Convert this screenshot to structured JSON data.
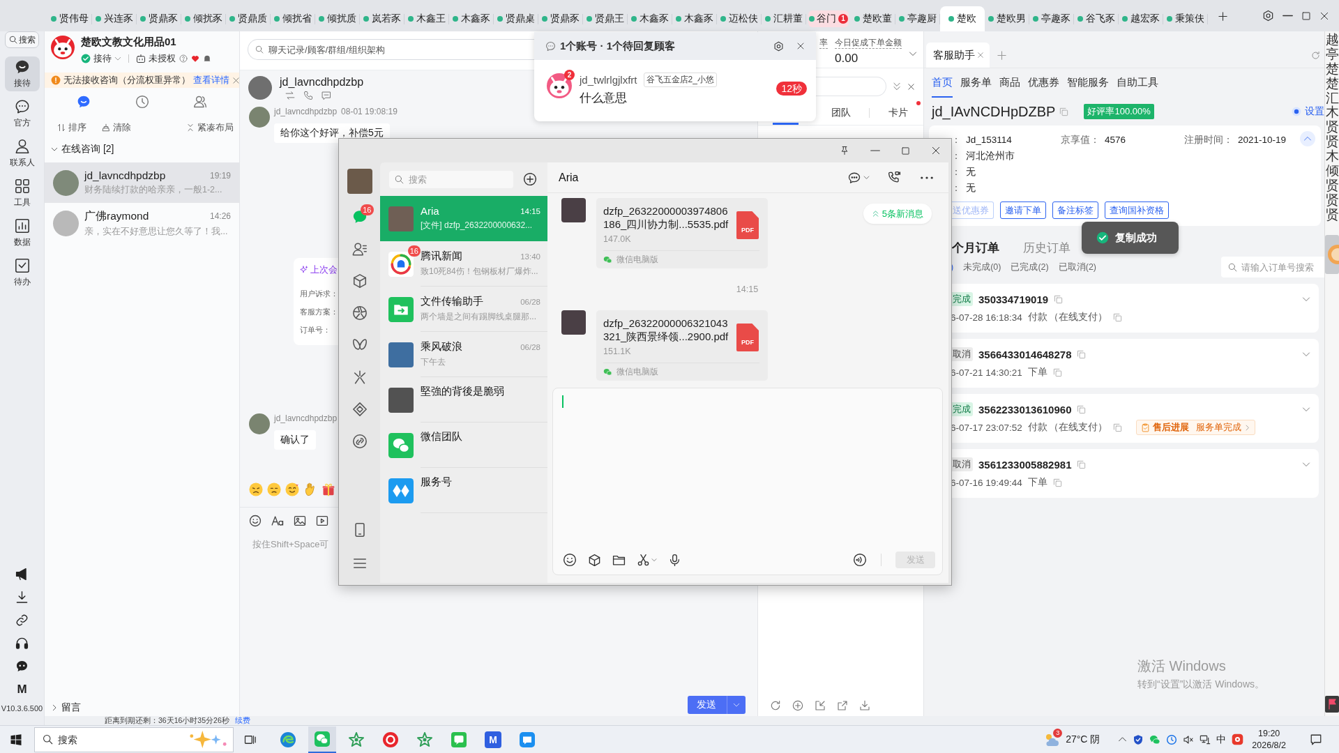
{
  "shop_tabs": [
    {
      "label": "贤伟母",
      "selected": false
    },
    {
      "label": "兴连豕",
      "selected": false
    },
    {
      "label": "贤鼎豕",
      "selected": false
    },
    {
      "label": "倾扰豕",
      "selected": false
    },
    {
      "label": "贤鼎质",
      "selected": false
    },
    {
      "label": "倾扰省",
      "selected": false
    },
    {
      "label": "倾扰质",
      "selected": false
    },
    {
      "label": "岚若豕",
      "selected": false
    },
    {
      "label": "木鑫王",
      "selected": false
    },
    {
      "label": "木鑫豕",
      "selected": false
    },
    {
      "label": "贤鼎桌",
      "selected": false
    },
    {
      "label": "贤鼎豕",
      "selected": false
    },
    {
      "label": "贤鼎王",
      "selected": false
    },
    {
      "label": "木鑫豕",
      "selected": false
    },
    {
      "label": "木鑫豕",
      "selected": false
    },
    {
      "label": "迈松伕",
      "selected": false
    },
    {
      "label": "汇耕董",
      "selected": false
    },
    {
      "label": "谷门",
      "selected": false,
      "badge": "1"
    },
    {
      "label": "楚欧董",
      "selected": false
    },
    {
      "label": "亭趣厨",
      "selected": false
    },
    {
      "label": "楚欧",
      "selected": true
    },
    {
      "label": "楚欧男",
      "selected": false
    },
    {
      "label": "亭趣豕",
      "selected": false
    },
    {
      "label": "谷飞豕",
      "selected": false
    },
    {
      "label": "越宏豕",
      "selected": false
    },
    {
      "label": "秉策伕",
      "selected": false
    }
  ],
  "rail": {
    "search": "搜索",
    "items": [
      {
        "label": "接待",
        "selected": true
      },
      {
        "label": "官方",
        "selected": false
      },
      {
        "label": "联系人",
        "selected": false
      },
      {
        "label": "工具",
        "selected": false
      },
      {
        "label": "数据",
        "selected": false
      },
      {
        "label": "待办",
        "selected": false
      }
    ],
    "brand_letter": "M",
    "version": "V10.3.6.500"
  },
  "account": {
    "name": "楚欧文教文化用品01",
    "status": "接待",
    "auth": "未授权"
  },
  "notice": {
    "text": "无法接收咨询（分流权重异常）",
    "link": "查看详情"
  },
  "list_tabs": [
    {
      "selected": true
    },
    {
      "selected": false
    },
    {
      "selected": false
    }
  ],
  "list_tools": [
    "排序",
    "清除",
    "紧凑布局"
  ],
  "consult_group": {
    "label": "在线咨询 [2]",
    "expanded": true
  },
  "conversations": [
    {
      "name": "jd_lavncdhpdzbp",
      "time": "19:19",
      "preview": "财务陆续打款的哈亲亲，一般1-2...",
      "selected": true
    },
    {
      "name": "广佛raymond",
      "time": "14:26",
      "preview": "亲，实在不好意思让您久等了！我...",
      "selected": false
    }
  ],
  "message_group": {
    "label": "留言",
    "expanded": false
  },
  "chat": {
    "search_placeholder": "聊天记录/顾客/群组/组织架构",
    "contact": "jd_lavncdhpdzbp",
    "messages": [
      {
        "kind": "text",
        "sender": "jd_lavncdhpdzbp",
        "time": "08-01 19:08:19",
        "text": "给你这个好评，补偿5元"
      },
      {
        "kind": "summary",
        "title": "上次会",
        "lines": [
          "用户诉求：",
          "客服方案：",
          "订单号："
        ]
      },
      {
        "kind": "text",
        "sender": "jd_lavncdhpdzbp",
        "text": "确认了"
      }
    ],
    "input_placeholder": "按住Shift+Space可",
    "send": "发送"
  },
  "expiry": {
    "text": "距离到期还剩：36天16小时35分26秒",
    "link": "续费"
  },
  "stats": [
    {
      "label": "率"
    },
    {
      "label": "今日促成下单金额",
      "value": "0.00"
    }
  ],
  "data_tabs": [
    {
      "selected": true
    },
    {
      "label": "团队",
      "selected": false
    },
    {
      "label": "卡片",
      "selected": false,
      "unread": true
    }
  ],
  "assistant": {
    "tabs": [
      {
        "label": "客服助手",
        "selected": true
      }
    ],
    "nav": [
      {
        "label": "首页",
        "selected": true
      },
      {
        "label": "服务单",
        "selected": false
      },
      {
        "label": "商品",
        "selected": false
      },
      {
        "label": "优惠券",
        "selected": false
      },
      {
        "label": "智能服务",
        "selected": false
      },
      {
        "label": "自助工具",
        "selected": false
      }
    ],
    "customer": {
      "id": "jd_IAvNCDHpDZBP",
      "rating": "好评率100.00%",
      "setting": "设置",
      "setting_on": true
    },
    "info": [
      {
        "label": "：",
        "value": "Jd_153114"
      },
      {
        "label": "京享值：",
        "value": "4576"
      },
      {
        "label": "注册时间：",
        "value": "2021-10-19"
      },
      {
        "label": "：",
        "value": "河北沧州市"
      },
      {
        "label": "：",
        "value": "无"
      },
      {
        "label": "：",
        "value": "无"
      }
    ],
    "info_expanded": true,
    "actions": [
      {
        "label": "送优惠券",
        "disabled": true
      },
      {
        "label": "邀请下单",
        "disabled": false
      },
      {
        "label": "备注标签",
        "disabled": false
      },
      {
        "label": "查询国补资格",
        "disabled": false
      }
    ],
    "order_tabs": [
      {
        "label": "个月订单",
        "selected": true
      },
      {
        "label": "历史订单",
        "selected": false
      }
    ],
    "filters": [
      {
        "label": ")",
        "selected": true
      },
      {
        "label": "未完成(0)",
        "selected": false
      },
      {
        "label": "已完成(2)",
        "selected": false
      },
      {
        "label": "已取消(2)",
        "selected": false
      }
    ],
    "order_search_placeholder": "请输入订单号搜索",
    "orders": [
      {
        "kind": "done",
        "status": "完成",
        "number": "350334719019",
        "time": "6-07-28 16:18:34",
        "action": "付款",
        "payment": "（在线支付）",
        "expanded": false
      },
      {
        "kind": "cancelled",
        "status": "取消",
        "number": "3566433014648278",
        "time": "6-07-21 14:30:21",
        "action": "下单",
        "expanded": false
      },
      {
        "kind": "done",
        "status": "完成",
        "number": "3562233013610960",
        "time": "6-07-17 23:07:52",
        "action": "付款",
        "payment": "（在线支付）",
        "after_sale": {
          "label": "售后进展",
          "status": "服务单完成"
        },
        "expanded": false
      },
      {
        "kind": "cancelled",
        "status": "取消",
        "number": "3561233005882981",
        "time": "6-07-16 19:49:44",
        "action": "下单",
        "expanded": false
      }
    ]
  },
  "side_strip": {
    "text": "越亭楚楚汇木贤贤木倾贤贤贤"
  },
  "notification": {
    "title": "1个账号 · 1个待回复顾客",
    "items": [
      {
        "name": "jd_twlrlgjlxfrt",
        "badge": "2",
        "tag": "谷飞五金店2_小悠",
        "message": "什么意思",
        "wait": "12秒"
      }
    ]
  },
  "wechat": {
    "nav": [
      {
        "selected": true,
        "badge": "16"
      },
      {
        "selected": false
      },
      {
        "selected": false
      },
      {
        "selected": false
      },
      {
        "selected": false
      },
      {
        "selected": false
      },
      {
        "selected": false
      },
      {
        "selected": false
      }
    ],
    "search_placeholder": "搜索",
    "chats": [
      {
        "kind": "photo",
        "name": "Aria",
        "time": "14:15",
        "preview": "[文件] dzfp_2632200000632...",
        "selected": true
      },
      {
        "kind": "news",
        "name": "腾讯新闻",
        "time": "13:40",
        "preview": "致10死84伤！包钢板材厂爆炸...",
        "badge": "16",
        "selected": false
      },
      {
        "kind": "files",
        "name": "文件传输助手",
        "time": "06/28",
        "preview": "两个墙是之间有踢脚线桌腿那...",
        "selected": false
      },
      {
        "kind": "photo",
        "name": "乘风破浪",
        "time": "06/28",
        "preview": "下午去",
        "selected": false
      },
      {
        "kind": "photo",
        "name": "堅強的背後是脆弱",
        "selected": false
      },
      {
        "kind": "team",
        "name": "微信团队",
        "selected": false
      },
      {
        "kind": "service",
        "name": "服务号",
        "selected": false
      }
    ],
    "title": "Aria",
    "new_messages": "5条新消息",
    "messages": [
      {
        "kind": "file",
        "name": "dzfp_26322000003974806186_四川协力制...5535.pdf",
        "size": "147.0K",
        "source": "微信电脑版",
        "file_type": "PDF"
      },
      {
        "kind": "time",
        "text": "14:15"
      },
      {
        "kind": "file",
        "name": "dzfp_26322000006321043321_陕西景绎领...2900.pdf",
        "size": "151.1K",
        "source": "微信电脑版",
        "file_type": "PDF"
      }
    ],
    "send": "发送",
    "send_disabled": true
  },
  "toast": {
    "text": "复制成功"
  },
  "activation": {
    "title": "激活 Windows",
    "hint": "转到“设置”以激活 Windows。"
  },
  "taskbar": {
    "search_placeholder": "搜索",
    "app_letter": "M",
    "weather_badge": "3",
    "weather": "27°C 阴",
    "ime": "中",
    "time": "19:20",
    "date": "2026/8/2"
  }
}
